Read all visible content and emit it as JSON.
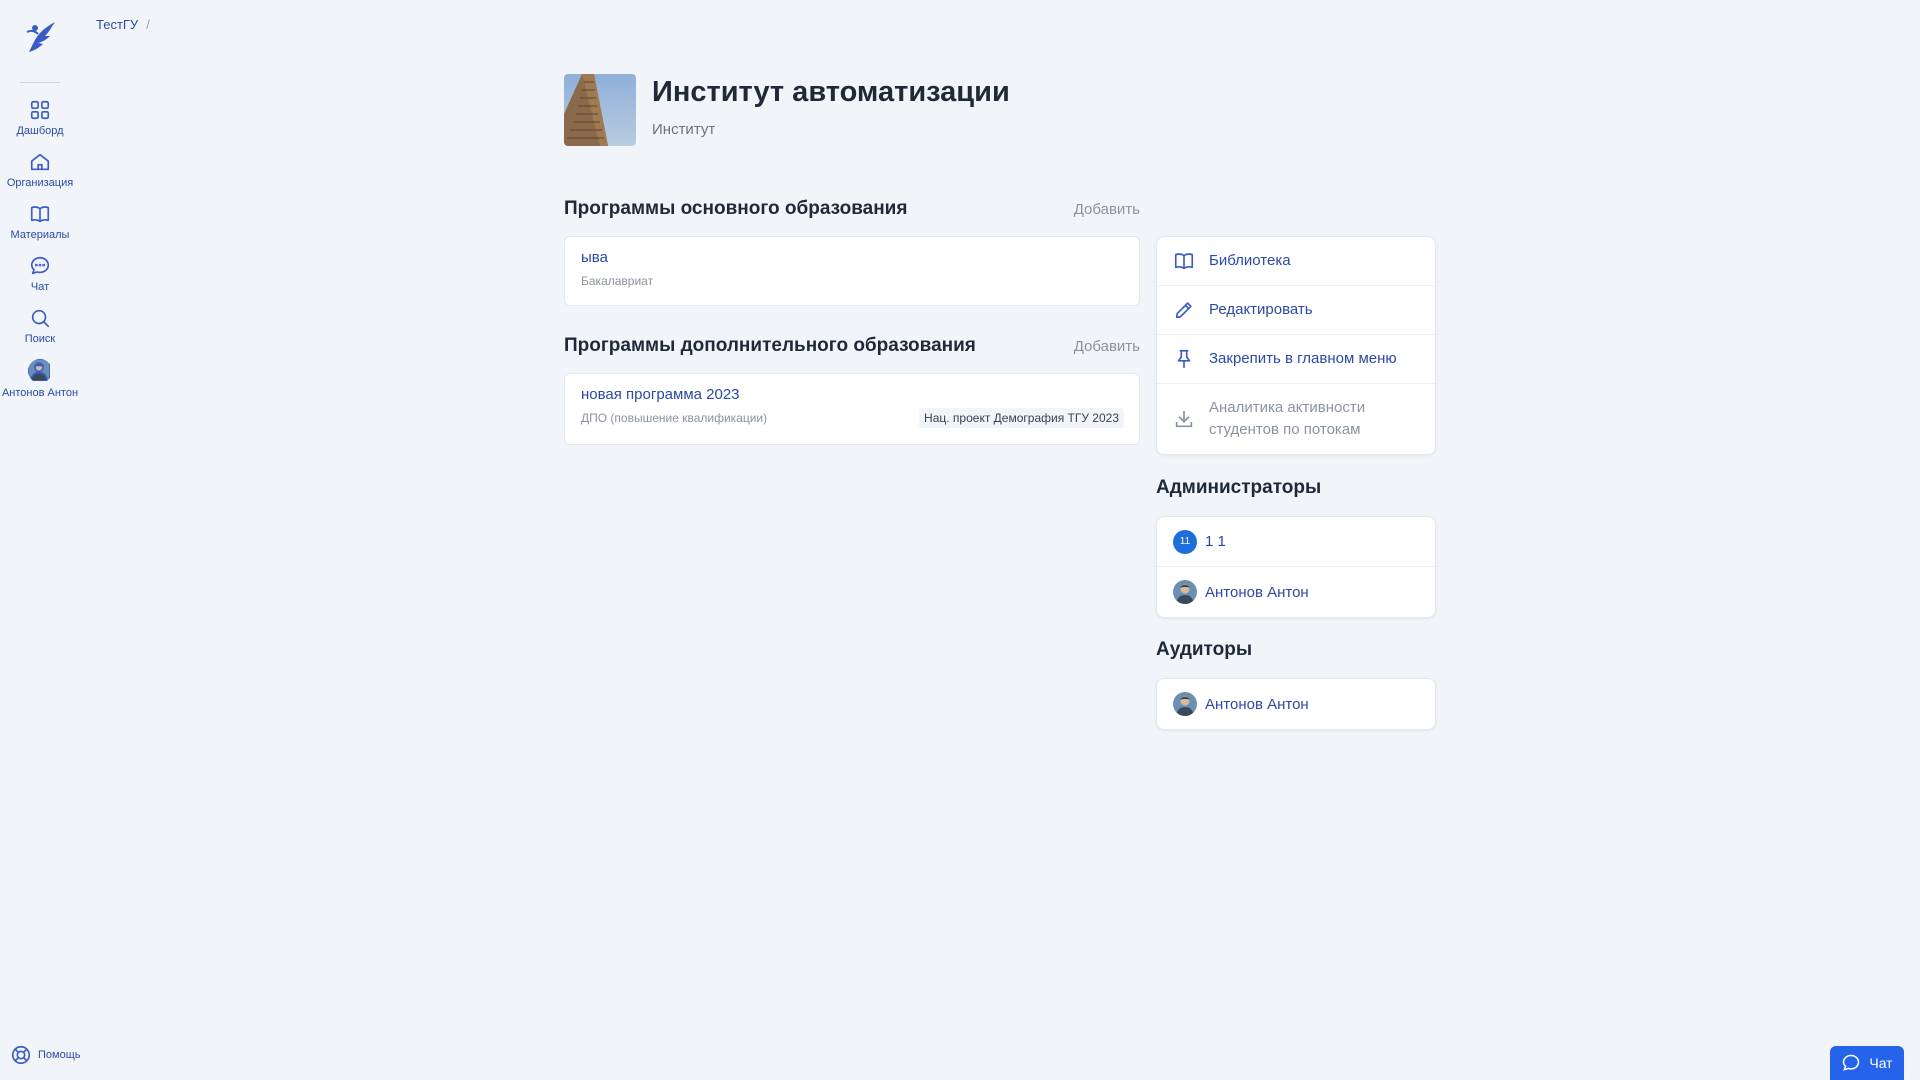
{
  "sidebar": {
    "items": [
      {
        "label": "Дашборд",
        "icon": "dashboard-icon"
      },
      {
        "label": "Организация",
        "icon": "home-icon"
      },
      {
        "label": "Материалы",
        "icon": "book-icon"
      },
      {
        "label": "Чат",
        "icon": "chat-icon"
      },
      {
        "label": "Поиск",
        "icon": "search-icon"
      },
      {
        "label": "Антонов Антон",
        "icon": "avatar"
      }
    ],
    "help_label": "Помощь"
  },
  "breadcrumb": {
    "root": "ТестГУ",
    "separator": "/"
  },
  "header": {
    "title": "Институт автоматизации",
    "subtitle": "Институт"
  },
  "main_programs": {
    "title": "Программы основного образования",
    "add_label": "Добавить",
    "items": [
      {
        "name": "ыва",
        "level": "Бакалавриат"
      }
    ]
  },
  "extra_programs": {
    "title": "Программы дополнительного образования",
    "add_label": "Добавить",
    "items": [
      {
        "name": "новая программа 2023",
        "level": "ДПО (повышение квалификации)",
        "tag": "Нац. проект Демография ТГУ 2023"
      }
    ]
  },
  "actions": [
    {
      "label": "Библиотека",
      "icon": "book-icon",
      "enabled": true
    },
    {
      "label": "Редактировать",
      "icon": "pencil-icon",
      "enabled": true
    },
    {
      "label": "Закрепить в главном меню",
      "icon": "pin-icon",
      "enabled": true
    },
    {
      "label": "Аналитика активности студентов по потокам",
      "icon": "download-icon",
      "enabled": false
    }
  ],
  "admins": {
    "title": "Администраторы",
    "items": [
      {
        "initials": "11",
        "name": "1 1"
      },
      {
        "initials": "",
        "name": "Антонов Антон"
      }
    ]
  },
  "auditors": {
    "title": "Аудиторы",
    "items": [
      {
        "name": "Антонов Антон"
      }
    ]
  },
  "chat_fab": {
    "label": "Чат"
  },
  "colors": {
    "accent": "#2b4aa3",
    "background": "#f1f5f9",
    "fab": "#2563eb"
  }
}
